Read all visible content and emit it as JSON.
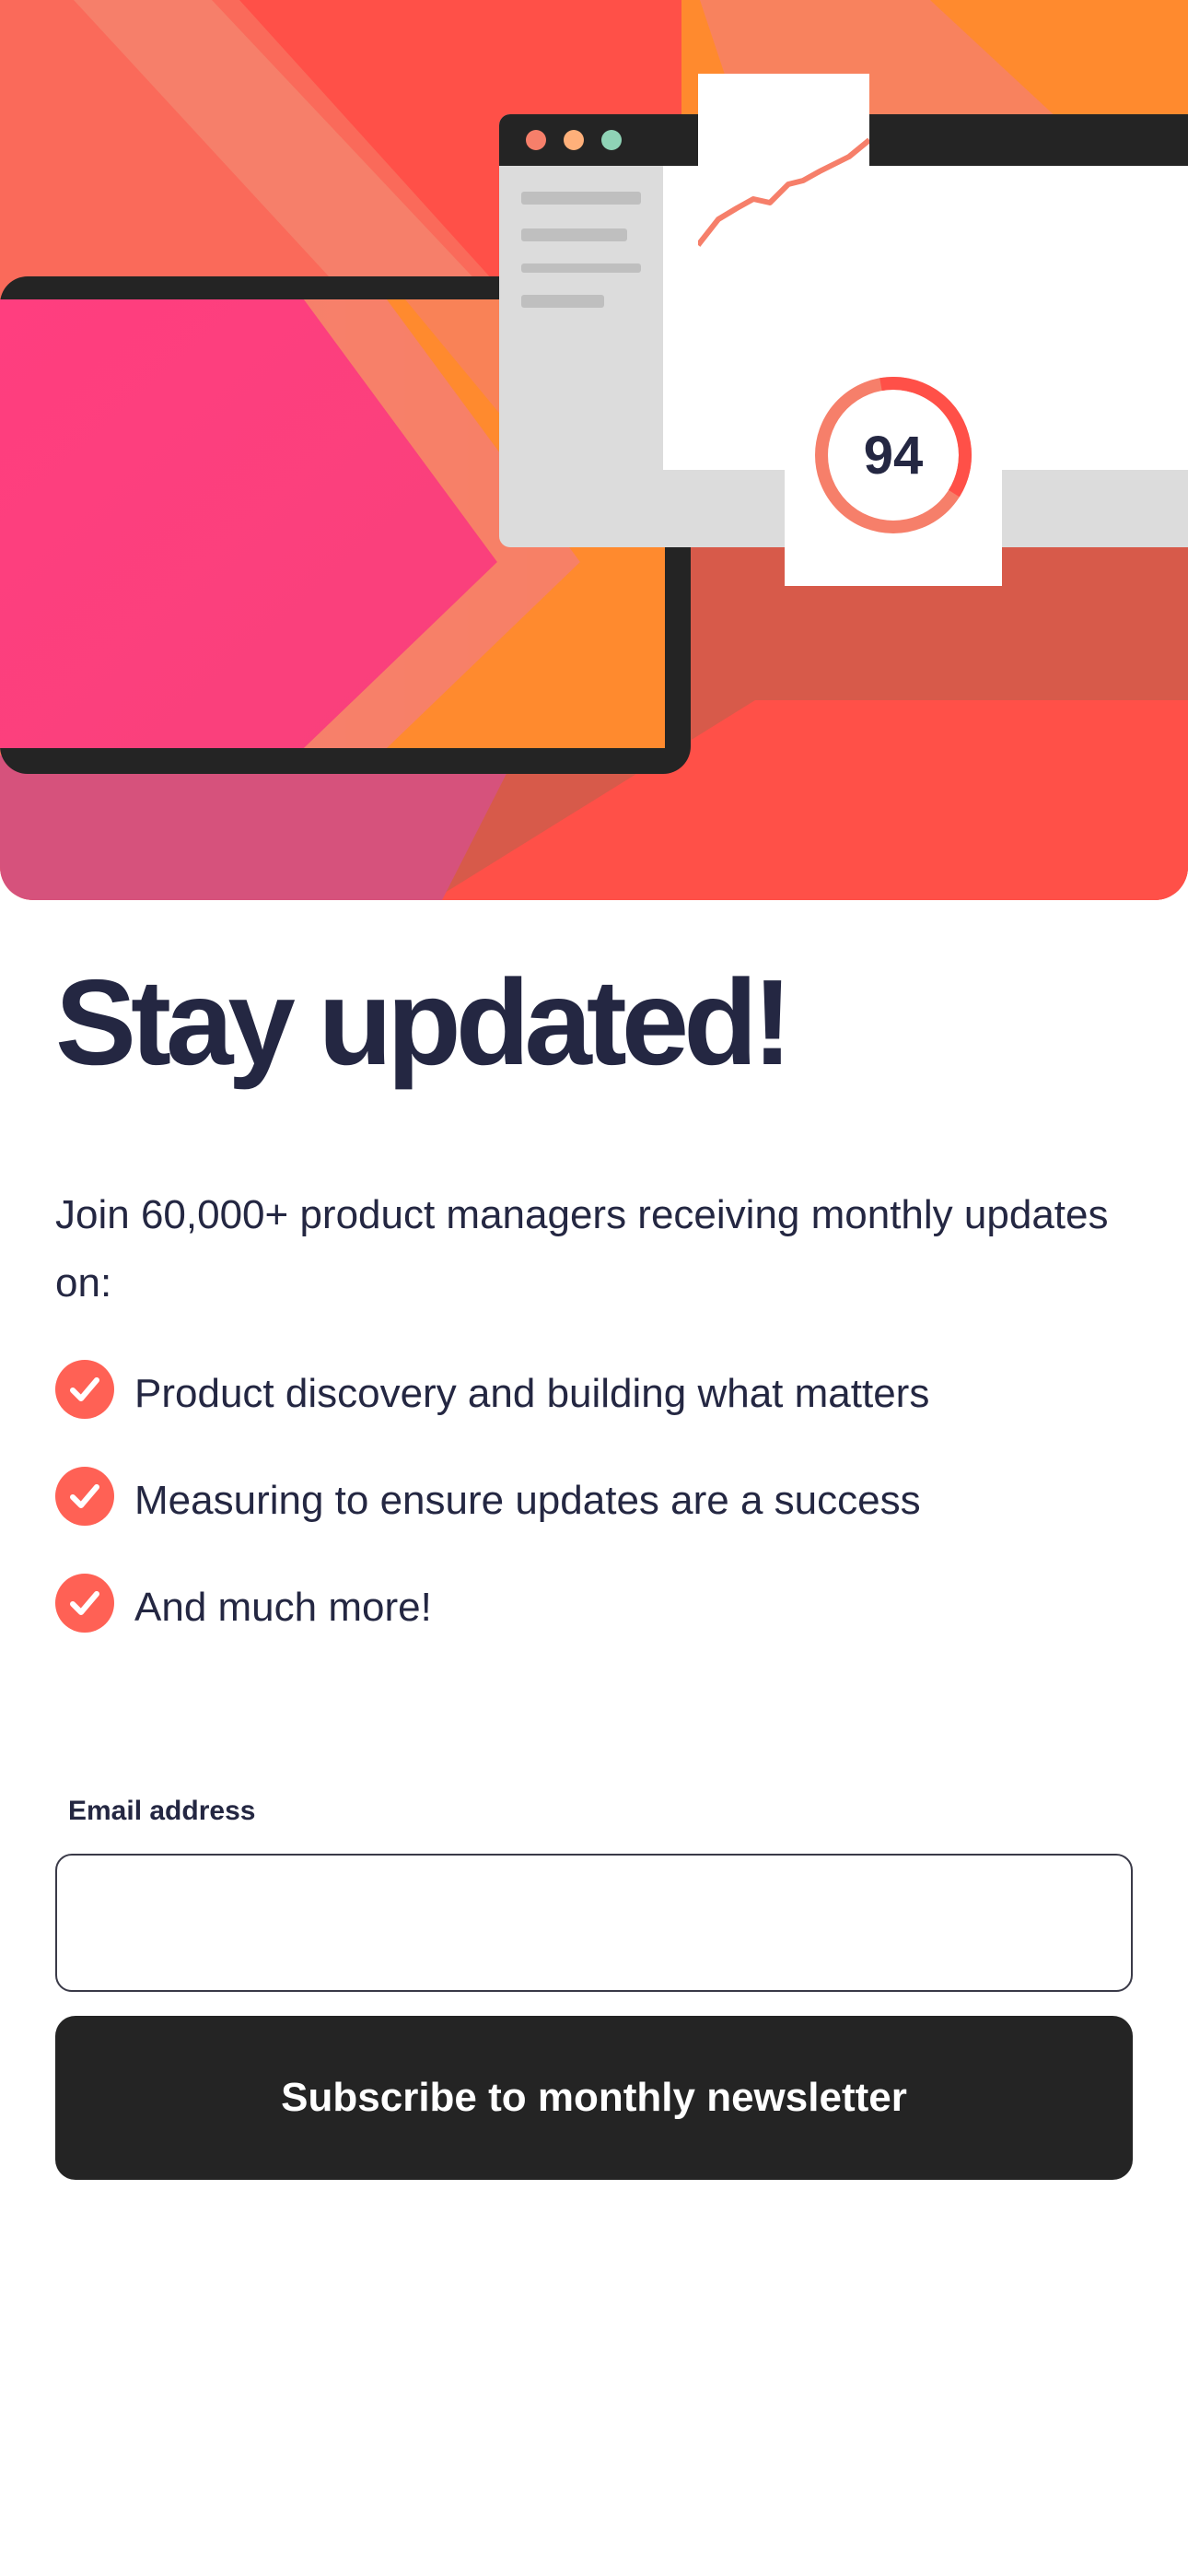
{
  "hero": {
    "score": "94",
    "colors": {
      "red": "#FF5048",
      "coral": "#F67F6A",
      "pink": "#FF3E7F",
      "orange": "#FF8A2E",
      "dark": "#242424"
    }
  },
  "title": "Stay updated!",
  "intro": "Join 60,000+ product managers receiving monthly updates on:",
  "benefits": [
    "Product discovery and building what matters",
    "Measuring to ensure updates are a success",
    "And much more!"
  ],
  "form": {
    "email_label": "Email address",
    "email_value": "",
    "subscribe_label": "Subscribe to monthly newsletter"
  },
  "icons": {
    "benefit": "check-circle-icon"
  }
}
